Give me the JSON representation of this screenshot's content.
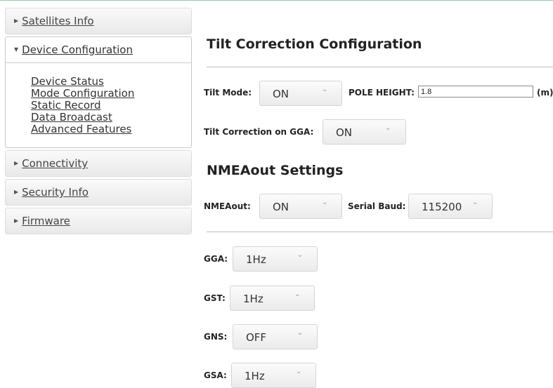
{
  "sidebar": {
    "satellites": "Satellites Info",
    "device_config": "Device Configuration",
    "device_items": [
      "Device Status",
      "Mode Configuration",
      "Static Record",
      "Data Broadcast",
      "Advanced Features"
    ],
    "connectivity": "Connectivity",
    "security": "Security Info",
    "firmware": "Firmware"
  },
  "tilt": {
    "title": "Tilt Correction Configuration",
    "mode_label": "Tilt Mode:",
    "mode_value": "ON",
    "pole_label": "POLE HEIGHT:",
    "pole_value": "1.8",
    "pole_unit": "(m)",
    "gga_label": "Tilt Correction on GGA:",
    "gga_value": "ON"
  },
  "nmea": {
    "title": "NMEAout Settings",
    "out_label": "NMEAout:",
    "out_value": "ON",
    "baud_label": "Serial Baud:",
    "baud_value": "115200",
    "messages": [
      {
        "label": "GGA:",
        "value": "1Hz"
      },
      {
        "label": "GST:",
        "value": "1Hz"
      },
      {
        "label": "GNS:",
        "value": "OFF"
      },
      {
        "label": "GSA:",
        "value": "1Hz"
      }
    ]
  },
  "icons": {
    "collapsed": "triangle-right-icon",
    "expanded": "triangle-down-icon",
    "caret": "caret-down-icon"
  },
  "colors": {
    "accent_line": "#8fc9a9"
  }
}
